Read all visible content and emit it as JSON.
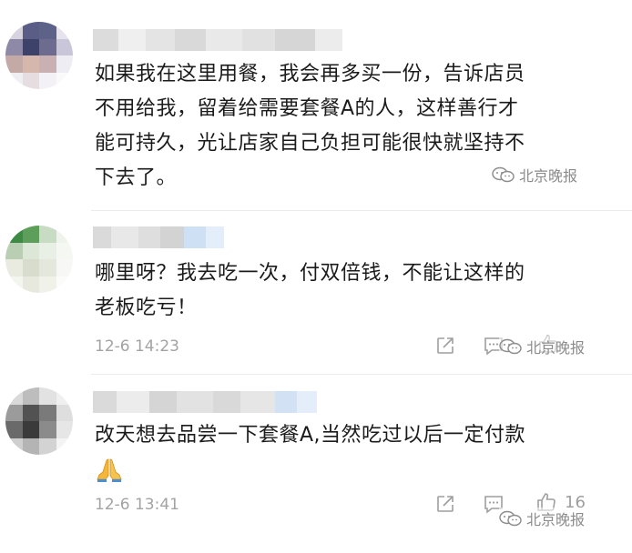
{
  "comments": [
    {
      "text_lines": [
        "如果我在这里用餐，我会再多买一份，告诉店员",
        "不用给我，留着给需要套餐A的人，这样善行才",
        "能可持久，光让店家自己负担可能很快就坚持不",
        "下去了。"
      ],
      "watermark": "北京晚报"
    },
    {
      "text_lines": [
        "哪里呀？我去吃一次，付双倍钱，不能让这样的",
        "老板吃亏！"
      ],
      "time": "12-6 14:23",
      "watermark": "北京晚报"
    },
    {
      "text_lines": [
        "改天想去品尝一下套餐A,当然吃过以后一定付款"
      ],
      "emoji": "folded-hands-icon",
      "time": "12-6 13:41",
      "like_count": "16",
      "watermark": "北京晚报"
    }
  ],
  "icons": {
    "share": "share-icon",
    "comment": "comment-icon",
    "like": "thumbs-up-icon",
    "watermark_logo": "wechat-logo-icon"
  },
  "colors": {
    "text": "#1b1b1b",
    "meta": "#a3a3a3",
    "icon": "#9e9e9e",
    "divider": "#ececec"
  }
}
